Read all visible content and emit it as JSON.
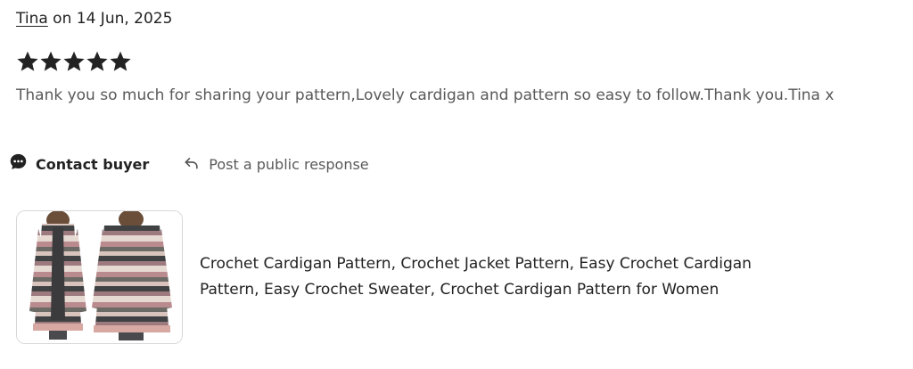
{
  "review": {
    "reviewer_name": "Tina",
    "date_text": " on 14 Jun, 2025",
    "rating": 5,
    "rating_max": 5,
    "text": "Thank you so much for sharing your pattern,Lovely cardigan and pattern so easy to follow.Thank you.Tina x"
  },
  "actions": {
    "contact_label": "Contact buyer",
    "contact_icon": "chat-bubble-icon",
    "respond_label": "Post a public response",
    "respond_icon": "reply-arrow-icon"
  },
  "listing": {
    "title": "Crochet Cardigan Pattern, Crochet Jacket Pattern, Easy Crochet Cardigan Pattern, Easy Crochet Sweater, Crochet Cardigan Pattern for Women",
    "image_alt": "striped crochet cardigan front and back view"
  },
  "colors": {
    "text": "#222222",
    "muted": "#595959",
    "stars": "#222222",
    "thumb_border": "#d8d8d8"
  }
}
